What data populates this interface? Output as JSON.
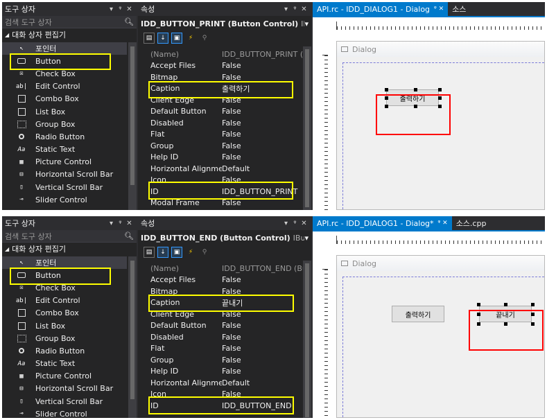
{
  "toolbox": {
    "title": "도구 상자",
    "search_placeholder": "검색 도구 상자",
    "group": "대화 상자 편집기",
    "items": [
      {
        "label": "포인터",
        "icon": "pointer-icon"
      },
      {
        "label": "Button",
        "icon": "button-icon"
      },
      {
        "label": "Check Box",
        "icon": "checkbox-icon"
      },
      {
        "label": "Edit Control",
        "icon": "edit-control-icon"
      },
      {
        "label": "Combo Box",
        "icon": "combo-box-icon"
      },
      {
        "label": "List Box",
        "icon": "list-box-icon"
      },
      {
        "label": "Group Box",
        "icon": "group-box-icon"
      },
      {
        "label": "Radio Button",
        "icon": "radio-button-icon"
      },
      {
        "label": "Static Text",
        "icon": "static-text-icon"
      },
      {
        "label": "Picture Control",
        "icon": "picture-control-icon"
      },
      {
        "label": "Horizontal Scroll Bar",
        "icon": "hscroll-icon"
      },
      {
        "label": "Vertical Scroll Bar",
        "icon": "vscroll-icon"
      },
      {
        "label": "Slider Control",
        "icon": "slider-icon"
      }
    ],
    "header_buttons": [
      "▾",
      "ᵠ",
      "✕"
    ]
  },
  "top": {
    "properties": {
      "title": "속성",
      "object_name": "IDD_BUTTON_PRINT (Button Control)",
      "object_type": "IButtonE",
      "rows": [
        {
          "name": "(Name)",
          "value": "IDD_BUTTON_PRINT (Butto"
        },
        {
          "name": "Accept Files",
          "value": "False"
        },
        {
          "name": "Bitmap",
          "value": "False"
        },
        {
          "name": "Caption",
          "value": "출력하기"
        },
        {
          "name": "Client Edge",
          "value": "False"
        },
        {
          "name": "Default Button",
          "value": "False"
        },
        {
          "name": "Disabled",
          "value": "False"
        },
        {
          "name": "Flat",
          "value": "False"
        },
        {
          "name": "Group",
          "value": "False"
        },
        {
          "name": "Help ID",
          "value": "False"
        },
        {
          "name": "Horizontal Alignment",
          "value": "Default"
        },
        {
          "name": "Icon",
          "value": "False"
        },
        {
          "name": "ID",
          "value": "IDD_BUTTON_PRINT"
        },
        {
          "name": "Modal Frame",
          "value": "False"
        }
      ]
    },
    "designer": {
      "tabs": [
        {
          "label": "API.rc - IDD_DIALOG1 - Dialog",
          "pin": "ᵠ ✕",
          "active": true
        },
        {
          "label": "소스",
          "pin": "",
          "active": false
        }
      ],
      "dialog_title": "Dialog",
      "buttons": [
        {
          "label": "출력하기"
        }
      ]
    }
  },
  "bottom": {
    "properties": {
      "title": "속성",
      "object_name": "IDD_BUTTON_END (Button Control)",
      "object_type": "IButtonEdi",
      "rows": [
        {
          "name": "(Name)",
          "value": "IDD_BUTTON_END (Button"
        },
        {
          "name": "Accept Files",
          "value": "False"
        },
        {
          "name": "Bitmap",
          "value": "False"
        },
        {
          "name": "Caption",
          "value": "끝내기"
        },
        {
          "name": "Client Edge",
          "value": "False"
        },
        {
          "name": "Default Button",
          "value": "False"
        },
        {
          "name": "Disabled",
          "value": "False"
        },
        {
          "name": "Flat",
          "value": "False"
        },
        {
          "name": "Group",
          "value": "False"
        },
        {
          "name": "Help ID",
          "value": "False"
        },
        {
          "name": "Horizontal Alignment",
          "value": "Default"
        },
        {
          "name": "Icon",
          "value": "False"
        },
        {
          "name": "ID",
          "value": "IDD_BUTTON_END"
        }
      ]
    },
    "designer": {
      "tabs": [
        {
          "label": "API.rc - IDD_DIALOG1 - Dialog*",
          "pin": "ᵠ ✕",
          "active": true
        },
        {
          "label": "소스.cpp",
          "pin": "",
          "active": false
        }
      ],
      "dialog_title": "Dialog",
      "buttons": [
        {
          "label": "출력하기"
        },
        {
          "label": "끝내기"
        }
      ]
    }
  },
  "colors": {
    "highlight_yellow": "#ffff00",
    "highlight_red": "#ff0000",
    "accent": "#007acc"
  }
}
